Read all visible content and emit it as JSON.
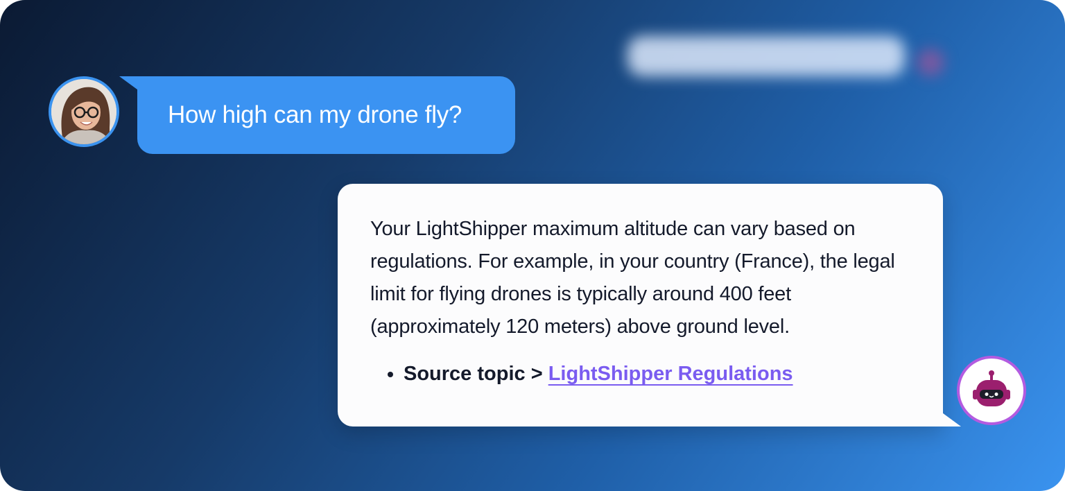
{
  "messages": {
    "user": {
      "text": "How high can my drone fly?"
    },
    "bot": {
      "text": "Your LightShipper maximum altitude can vary based on regulations. For example, in your country (France), the legal limit for flying drones is typically around 400 feet (approximately 120 meters) above ground level.",
      "source_label": "Source topic > ",
      "source_link": "LightShipper Regulations"
    }
  },
  "icons": {
    "user_avatar": "user-avatar-photo",
    "bot_avatar": "robot-icon"
  },
  "colors": {
    "user_bubble": "#3b93f2",
    "bot_bubble": "#fcfcfd",
    "link": "#7a5cf0",
    "bot_ring": "#b35be0",
    "robot": "#9b1f6e"
  }
}
